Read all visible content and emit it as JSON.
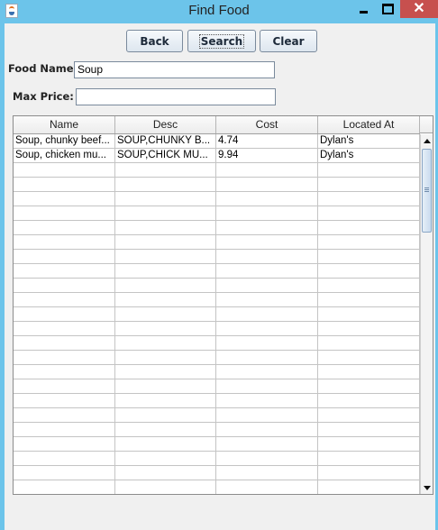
{
  "window": {
    "title": "Find Food"
  },
  "toolbar": {
    "back_label": "Back",
    "search_label": "Search",
    "clear_label": "Clear"
  },
  "form": {
    "food_name_label": "Food Name:",
    "food_name_value": "Soup",
    "max_price_label": "Max Price:",
    "max_price_value": ""
  },
  "table": {
    "columns": [
      "Name",
      "Desc",
      "Cost",
      "Located At"
    ],
    "rows": [
      [
        "Soup, chunky beef...",
        "SOUP,CHUNKY B...",
        "4.74",
        "Dylan's"
      ],
      [
        "Soup, chicken mu...",
        "SOUP,CHICK MU...",
        "9.94",
        "Dylan's"
      ]
    ]
  }
}
